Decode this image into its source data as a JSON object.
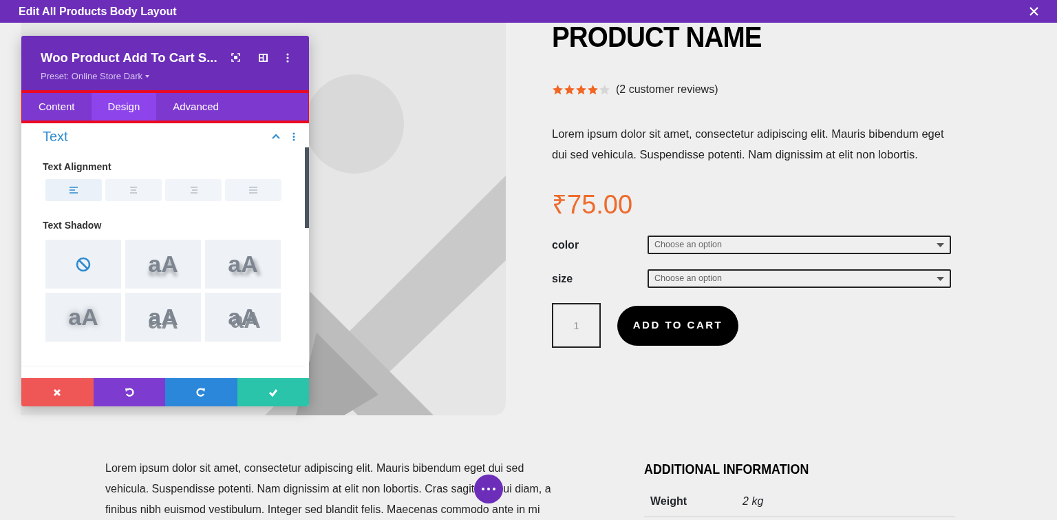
{
  "top_bar": {
    "title": "Edit All Products Body Layout"
  },
  "settings_panel": {
    "title": "Woo Product Add To Cart S...",
    "preset": "Preset: Online Store Dark",
    "tabs": [
      {
        "label": "Content",
        "selected": false
      },
      {
        "label": "Design",
        "selected": true
      },
      {
        "label": "Advanced",
        "selected": false
      }
    ],
    "section": {
      "title": "Text",
      "expanded": true
    },
    "text_alignment": {
      "label": "Text Alignment",
      "options": [
        {
          "kind": "left",
          "selected": true
        },
        {
          "kind": "center",
          "selected": false
        },
        {
          "kind": "right",
          "selected": false
        },
        {
          "kind": "justify",
          "selected": false
        }
      ]
    },
    "text_shadow": {
      "label": "Text Shadow",
      "options": [
        {
          "kind": "none"
        },
        {
          "kind": "drop",
          "sample": "aA"
        },
        {
          "kind": "corner",
          "sample": "aA"
        },
        {
          "kind": "glow",
          "sample": "aA"
        },
        {
          "kind": "offset",
          "sample": "aA"
        },
        {
          "kind": "solid",
          "sample": "aA"
        }
      ]
    },
    "actions": [
      {
        "kind": "cancel"
      },
      {
        "kind": "undo"
      },
      {
        "kind": "redo"
      },
      {
        "kind": "save"
      }
    ]
  },
  "product": {
    "name": "PRODUCT NAME",
    "stars": 4,
    "reviews": "(2 customer reviews)",
    "description": "Lorem ipsum dolor sit amet, consectetur adipiscing elit. Mauris bibendum eget dui sed vehicula. Suspendisse potenti. Nam dignissim at elit non lobortis.",
    "price": "₹75.00",
    "variations": [
      {
        "label": "color",
        "placeholder": "Choose an option"
      },
      {
        "label": "size",
        "placeholder": "Choose an option"
      }
    ],
    "quantity": "1",
    "add_to_cart": "ADD TO CART"
  },
  "long_description": {
    "lines": [
      [
        "Lorem ipsum dolor sit amet, consectetur adipiscing elit. Mauris bibendum eget dui sed"
      ],
      [
        "vehicula. Suspendisse potenti. Nam dignissim at elit non lobortis. Cras sagit",
        "ui diam, a"
      ],
      [
        "finibus nibh euismod vestibulum. Integer sed blandit felis. Maecenas commodo ante in mi"
      ]
    ]
  },
  "additional_information": {
    "title": "ADDITIONAL INFORMATION",
    "rows": [
      {
        "label": "Weight",
        "value": "2 kg"
      }
    ]
  }
}
